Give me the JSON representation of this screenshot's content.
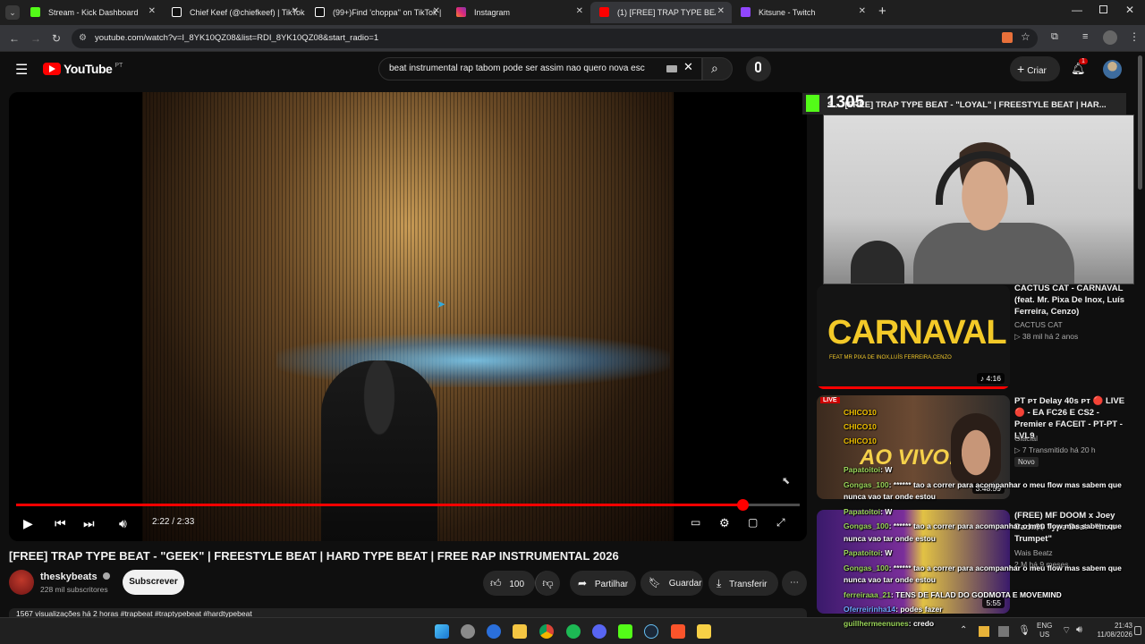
{
  "browser": {
    "tabs": [
      {
        "label": "Stream - Kick Dashboard",
        "color": "#53fc18"
      },
      {
        "label": "Chief Keef (@chiefkeef) | TikTok",
        "color": "#ffffff"
      },
      {
        "label": "(99+)Find 'choppa'' on TikTok |",
        "color": "#ffffff"
      },
      {
        "label": "Instagram",
        "color": "#e1306c"
      },
      {
        "label": "(1) [FREE] TRAP TYPE BEAT - \"G",
        "color": "#ff0000"
      },
      {
        "label": "Kitsune - Twitch",
        "color": "#9146ff"
      }
    ],
    "url": "youtube.com/watch?v=I_8YK10QZ08&list=RDI_8YK10QZ08&start_radio=1"
  },
  "youtube": {
    "logo_text": "YouTube",
    "region": "PT",
    "search_value": "beat instrumental rap tabom pode ser assim nao quero nova esc",
    "create_label": "Criar",
    "notifications_count": "1"
  },
  "player": {
    "time": "2:22 / 2:33",
    "progress": 0.927
  },
  "video": {
    "title": "[FREE] TRAP TYPE BEAT - \"GEEK\" | FREESTYLE BEAT | HARD TYPE BEAT | FREE RAP INSTRUMENTAL 2026",
    "channel": "theskybeats",
    "subscribers": "228 mil subscritores",
    "subscribe_label": "Subscrever",
    "likes": "100",
    "share_label": "Partilhar",
    "save_label": "Guardar",
    "download_label": "Transferir",
    "views_line": "1567 visualizações  há 2 horas  #trapbeat #traptypebeat #hardtypebeat"
  },
  "overlay": {
    "kick_viewers": "1305",
    "kick_title": "S ... [FREE] TRAP TYPE BEAT - \"LOYAL\" | FREESTYLE BEAT | HAR..."
  },
  "recommendations": [
    {
      "title": "CACTUS CAT - CARNAVAL (feat. Mr. Pixa De Inox, Luís Ferreira, Cenzo)",
      "channel": "CACTUS CAT",
      "meta": "▷ 38 mil  há 2 anos",
      "thumb_text": "CARNAVAL",
      "thumb_sub": "FEAT MR PIXA DE INOX,LUÍS FERREIRA,CENZO",
      "duration": "4:16"
    },
    {
      "title": "PT ᴘᴛ Delay 40s ᴘᴛ 🔴 LIVE 🔴 - EA FC26 E CS2 - Premier e FACEIT - PT-PT - LVL9",
      "channel": "Glacial",
      "meta": "▷ 7  Transmitido há 20 h",
      "badge": "Novo",
      "thumb_text": "AO VIVO!",
      "duration": "3:48:59",
      "live": "LIVE"
    },
    {
      "title": "(FREE) MF DOOM x Joey Bada$$ Type Beat - \"Low Trumpet\"",
      "channel": "Wais Beatz",
      "meta": "2 M  há 9 meses",
      "duration": "5:55"
    }
  ],
  "chat": [
    {
      "name": "CHICO10",
      "text": ""
    },
    {
      "name": "CHICO10",
      "text": ""
    },
    {
      "name": "CHICO10",
      "text": ""
    },
    {
      "name": "Papatoitoi",
      "text": ": W"
    },
    {
      "name": "Gongas_100",
      "text": ": ****** tao a correr para acompanhar o meu flow mas sabem que"
    },
    {
      "name": "",
      "text": "nunca vao tar onde estou"
    },
    {
      "name": "Papatoitoi",
      "text": ": W"
    },
    {
      "name": "Gongas_100",
      "text": ": ****** tao a correr para acompanhar o meu flow mas sabem que"
    },
    {
      "name": "",
      "text": "nunca vao tar onde estou"
    },
    {
      "name": "Papatoitoi",
      "text": ": W"
    },
    {
      "name": "Gongas_100",
      "text": ": ****** tao a correr para acompanhar o meu flow mas sabem que"
    },
    {
      "name": "",
      "text": "nunca vao tar onde estou"
    },
    {
      "name": "ferreiraaa_21",
      "text": ": TENS DE FALAD DO GODMOTA E MOVEMIND"
    },
    {
      "name": "Oferreirinha14",
      "text": ": podes fazer"
    },
    {
      "name": "guillhermeenunes",
      "text": ": credo"
    }
  ],
  "taskbar": {
    "lang": "ENG",
    "layout": "US",
    "time": "21:43",
    "date": "11/08/2026"
  },
  "colors": {
    "accent": "#ff0000",
    "kick": "#53fc18",
    "bg": "#0f0f0f"
  }
}
